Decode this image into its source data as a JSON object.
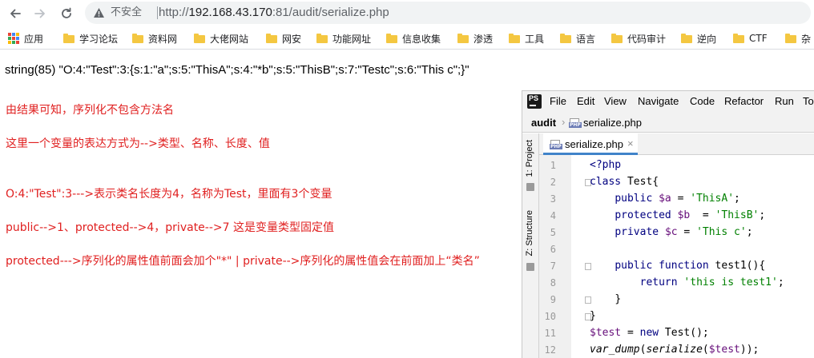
{
  "browser": {
    "security_label": "不安全",
    "url_scheme": "http://",
    "url_host": "192.168.43.170",
    "url_rest": ":81/audit/serialize.php"
  },
  "bookmarks": {
    "apps_label": "应用",
    "folders": [
      "学习论坛",
      "资料网",
      "大佬网站",
      "网安",
      "功能网址",
      "信息收集",
      "渗透",
      "工具",
      "语言",
      "代码审计",
      "逆向",
      "CTF",
      "杂"
    ]
  },
  "page": {
    "dump_output": "string(85) \"O:4:\"Test\":3:{s:1:\"a\";s:5:\"ThisA\";s:4:\"*b\";s:5:\"ThisB\";s:7:\"Testc\";s:6:\"This c\";}\"",
    "notes": [
      "由结果可知，序列化不包含方法名",
      "这里一个变量的表达方式为-->类型、名称、长度、值",
      "O:4:\"Test\":3--->表示类名长度为4，名称为Test，里面有3个变量",
      "public-->1、protected-->4，private-->7 这是变量类型固定值",
      "protected--->序列化的属性值前面会加个\"*\" | private-->序列化的属性值会在前面加上“类名”"
    ]
  },
  "ide": {
    "menu": [
      "File",
      "Edit",
      "View",
      "Navigate",
      "Code",
      "Refactor",
      "Run",
      "To"
    ],
    "breadcrumb_root": "audit",
    "breadcrumb_file": "serialize.php",
    "tab_label": "serialize.php",
    "tab_close": "×",
    "side_tabs": [
      "1: Project",
      "Z: Structure"
    ],
    "line_numbers": [
      "1",
      "2",
      "3",
      "4",
      "5",
      "6",
      "7",
      "8",
      "9",
      "10",
      "11",
      "12"
    ],
    "code": {
      "l1": "<?php",
      "l2_kw": "class",
      "l2_rest": " Test{",
      "l3_kw": "public",
      "l3_var": "$a",
      "l3_eq": " = ",
      "l3_str": "'ThisA'",
      "l3_end": ";",
      "l4_kw": "protected",
      "l4_var": "$b",
      "l4_eq": "  = ",
      "l4_str": "'ThisB'",
      "l4_end": ";",
      "l5_kw": "private",
      "l5_var": "$c",
      "l5_eq": " = ",
      "l5_str": "'This c'",
      "l5_end": ";",
      "l7_kw": "public function",
      "l7_rest": " test1(){",
      "l8_kw": "return",
      "l8_str": "'this is test1'",
      "l8_end": ";",
      "l9": "}",
      "l10": "}",
      "l11_var": "$test",
      "l11_eq": " = ",
      "l11_kw": "new",
      "l11_rest": " Test();",
      "l12_fn1": "var_dump",
      "l12_p1": "(",
      "l12_fn2": "serialize",
      "l12_p2": "(",
      "l12_var": "$test",
      "l12_end": "));"
    }
  },
  "colors": {
    "note_red": "#e02020",
    "php_keyword": "#000080",
    "php_variable": "#660e7a",
    "php_string": "#008000",
    "tab_underline": "#4083c9"
  }
}
